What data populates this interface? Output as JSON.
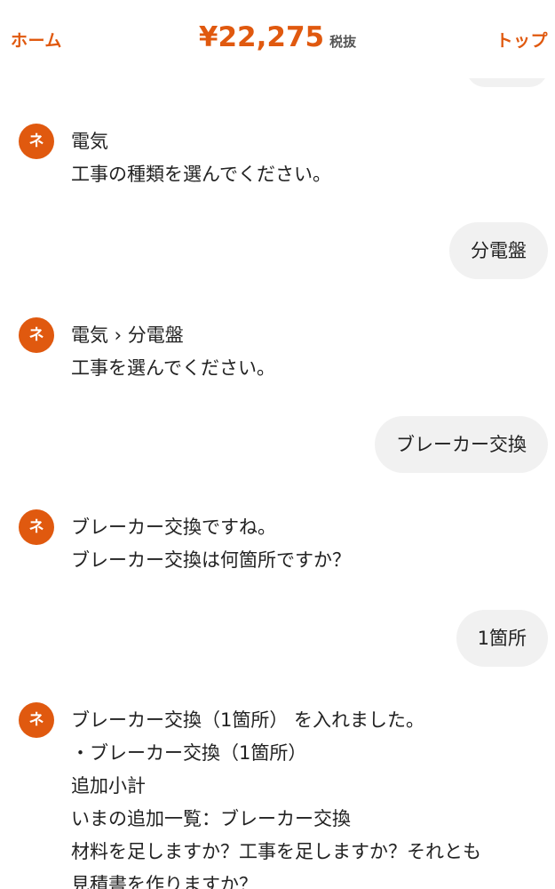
{
  "header": {
    "home_label": "ホーム",
    "price": "¥22,275",
    "tax_label": "税抜",
    "top_label": "トップ"
  },
  "avatar_label": "ネ",
  "messages": [
    {
      "role": "bot",
      "lines": [
        "電気",
        "工事の種類を選んでください。"
      ]
    },
    {
      "role": "user",
      "text": "分電盤"
    },
    {
      "role": "bot",
      "lines": [
        "電気 › 分電盤",
        "工事を選んでください。"
      ]
    },
    {
      "role": "user",
      "text": "ブレーカー交換"
    },
    {
      "role": "bot",
      "lines": [
        "ブレーカー交換ですね。",
        "ブレーカー交換は何箇所ですか？"
      ]
    },
    {
      "role": "user",
      "text": "1箇所"
    },
    {
      "role": "bot",
      "lines": [
        "ブレーカー交換（1箇所） を入れました。",
        "・ブレーカー交換（1箇所）",
        "追加小計",
        "いまの追加一覧：ブレーカー交換",
        "材料を足しますか？工事を足しますか？それとも",
        "見積書を作りますか？"
      ]
    }
  ]
}
